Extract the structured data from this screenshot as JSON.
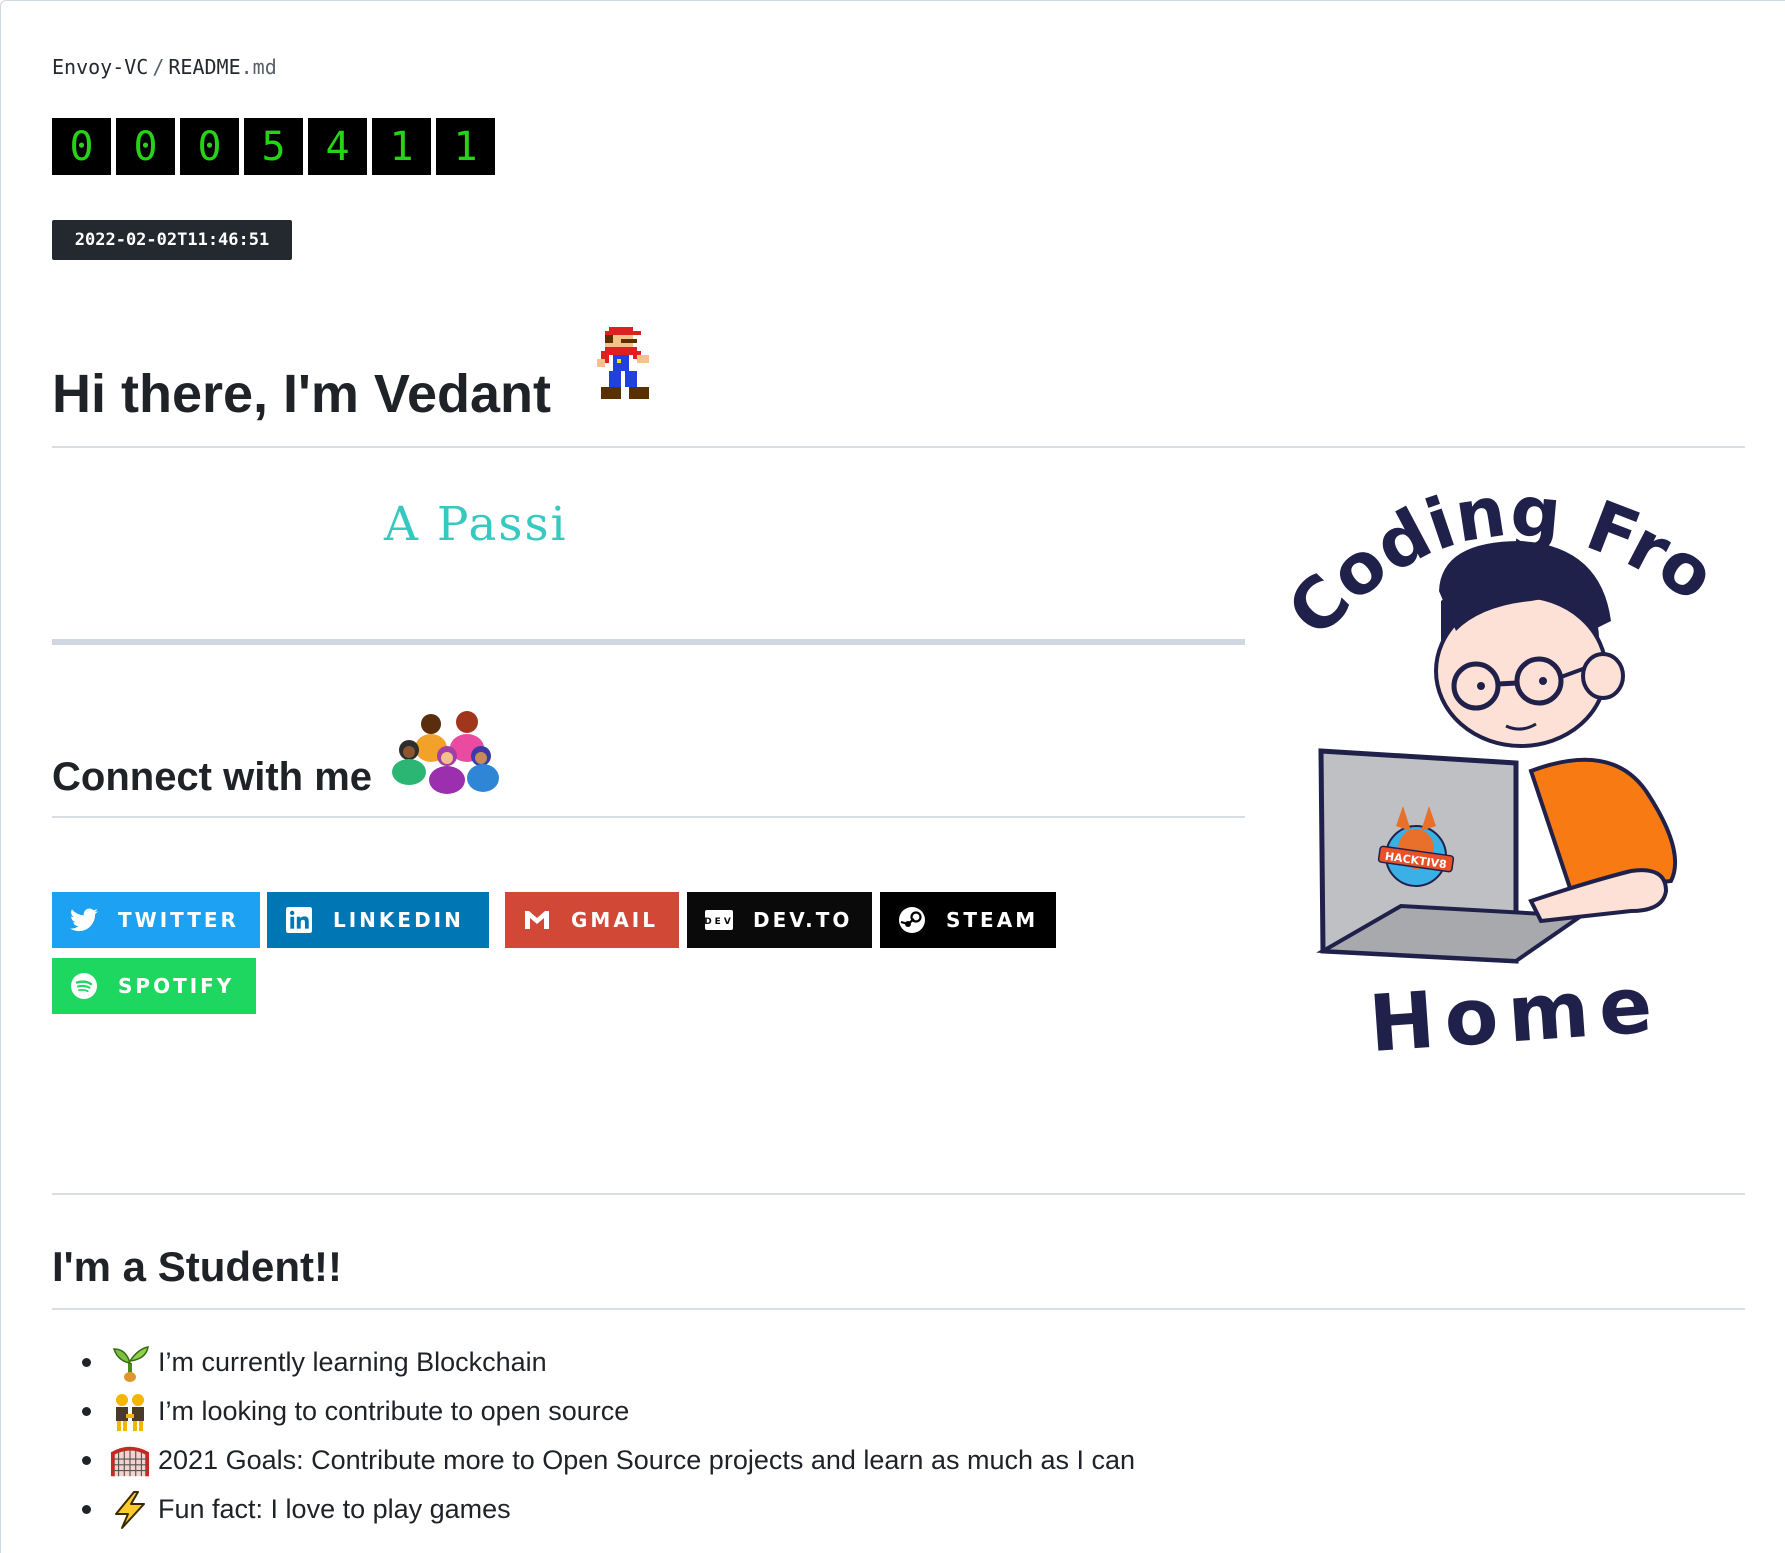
{
  "breadcrumb": {
    "repo": "Envoy-VC",
    "separator": "/",
    "file_name": "README",
    "file_ext": ".md"
  },
  "visitor_counter": {
    "digits": [
      "0",
      "0",
      "0",
      "5",
      "4",
      "1",
      "1"
    ]
  },
  "timestamp_badge": "2022-02-02T11:46:51",
  "heading": "Hi there, I'm Vedant",
  "typing_text": "A Passi",
  "connect": {
    "title": "Connect with me",
    "badges": [
      {
        "label": "TWITTER",
        "icon": "twitter-icon",
        "color": "#1da1f2"
      },
      {
        "label": "LINKEDIN",
        "icon": "linkedin-icon",
        "color": "#0077b5"
      },
      {
        "label": "GMAIL",
        "icon": "gmail-icon",
        "color": "#d14836"
      },
      {
        "label": "DEV.TO",
        "icon": "devto-icon",
        "color": "#0a0a0a"
      },
      {
        "label": "STEAM",
        "icon": "steam-icon",
        "color": "#000000"
      },
      {
        "label": "SPOTIFY",
        "icon": "spotify-icon",
        "color": "#1ed760"
      }
    ]
  },
  "illustration": {
    "top_text": "Coding From",
    "bottom_text": "Home",
    "sticker_text": "HACKTIV8"
  },
  "student": {
    "title": "I'm a Student!!",
    "items": [
      {
        "icon": "seedling-icon",
        "text": "I’m currently learning Blockchain"
      },
      {
        "icon": "people-holding-hands-icon",
        "text": "I’m looking to contribute to open source"
      },
      {
        "icon": "goal-net-icon",
        "text": "2021 Goals: Contribute more to Open Source projects and learn as much as I can"
      },
      {
        "icon": "lightning-icon",
        "text": "Fun fact: I love to play games"
      }
    ]
  }
}
